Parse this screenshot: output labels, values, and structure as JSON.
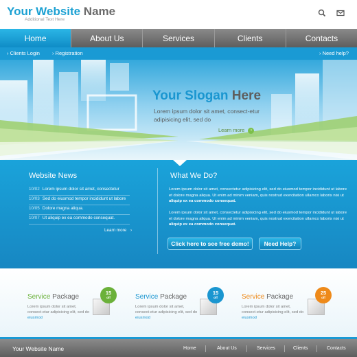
{
  "header": {
    "logo_part1": "Your Website",
    "logo_part2": "Name",
    "tagline": "Additional Text Here",
    "icons": [
      "search-icon",
      "mail-icon"
    ]
  },
  "nav": {
    "items": [
      "Home",
      "About Us",
      "Services",
      "Clients",
      "Contacts"
    ],
    "active_index": 0
  },
  "subnav": {
    "left": [
      "Clients Login",
      "Registration"
    ],
    "right": "Need help?"
  },
  "hero": {
    "slogan_part1": "Your Slogan",
    "slogan_part2": "Here",
    "text": "Lorem ipsum dolor sit amet, consect-etur adipisicing elit, sed do",
    "learn_more": "Learn more"
  },
  "news": {
    "title": "Website News",
    "items": [
      {
        "date": "10/02",
        "text": "Lorem ipsum dolor sit amet, consectetur"
      },
      {
        "date": "10/03",
        "text": "Sed do eiusmod tempor incididunt ut labore"
      },
      {
        "date": "10/05",
        "text": "Dolore magna aliqua."
      },
      {
        "date": "10/07",
        "text": "Ut aliquip ex ea commodo consequat."
      }
    ],
    "more": "Learn more"
  },
  "what": {
    "title": "What We Do?",
    "para1": "Lorem ipsum dolor sit amet, consectetur adipisicing elit, sed do eiusmod tempor incididunt ut labore et dolore magna aliqua. Ut enim ad minim veniam, quis nostrud exercitation ullamco laboris nisi ut",
    "para1_bold": "aliquip ex ea commodo consequat.",
    "para2": "Lorem ipsum dolor sit amet, consectetur adipisicing elit, sed do eiusmod tempor incididunt ut labore et dolore magna aliqua. Ut enim ad minim veniam, quis nostrud exercitation ullamco laboris nisi ut",
    "para2_bold": "aliquip ex ea commodo consequat.",
    "demo_button": "Click here to see free demo!",
    "help_button": "Need Help?"
  },
  "services": {
    "packages": [
      {
        "title_color": "Service",
        "title_rest": "Package",
        "color": "#6bb13a",
        "text": "Lorem ipsum dolor sit amet, consect-etur adipisicing elit, sed do",
        "more": "eiusmod",
        "badge_value": "15",
        "badge_unit": "off"
      },
      {
        "title_color": "Service",
        "title_rest": "Package",
        "color": "#1a96d0",
        "text": "Lorem ipsum dolor sit amet, consect-etur adipisicing elit, sed do",
        "more": "eiusmod",
        "badge_value": "15",
        "badge_unit": "off"
      },
      {
        "title_color": "Service",
        "title_rest": "Package",
        "color": "#ee8a1a",
        "text": "Lorem ipsum dolor sit amet, consect-etur adipisicing elit, sed do",
        "more": "eiusmod",
        "badge_value": "25",
        "badge_unit": "off"
      }
    ]
  },
  "footer": {
    "name": "Your Website Name",
    "links": [
      "Home",
      "About Us",
      "Services",
      "Clients",
      "Contacts"
    ]
  },
  "colors": {
    "accent": "#1a9ad4",
    "nav_gray": "#6e6e6e",
    "green": "#6bb13a",
    "orange": "#ee8a1a"
  }
}
